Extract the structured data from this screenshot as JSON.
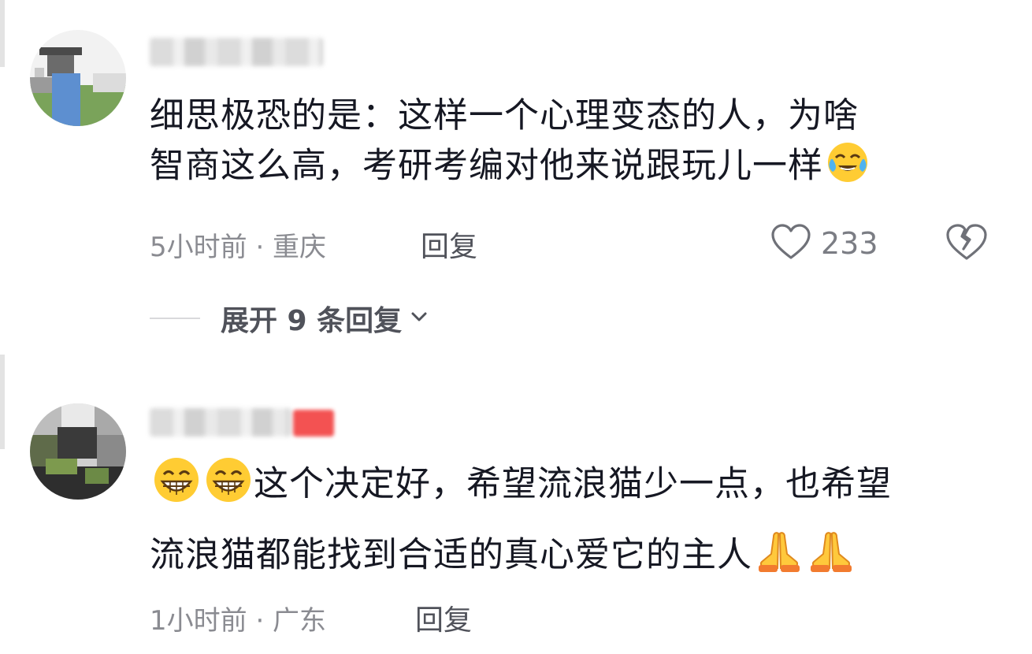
{
  "comments": [
    {
      "text_line1": "细思极恐的是：这样一个心理变态的人，为啥",
      "text_line2": "智商这么高，考研考编对他来说跟玩儿一样",
      "time_location": "5小时前 · 重庆",
      "reply_label": "回复",
      "like_count": "233",
      "expand_label": "展开 9 条回复",
      "emoji": "crying-laughing-emoji"
    },
    {
      "text_line1": "这个决定好，希望流浪猫少一点，也希望",
      "text_line2": "流浪猫都能找到合适的真心爱它的主人",
      "time_location": "1小时前 · 广东",
      "reply_label": "回复",
      "emoji_leading": "grinning-emoji",
      "emoji_trailing": "praying-hands-emoji"
    }
  ],
  "colors": {
    "text": "#161823",
    "meta": "#8a8b91",
    "emoji_yellow": "#ffcc33"
  }
}
